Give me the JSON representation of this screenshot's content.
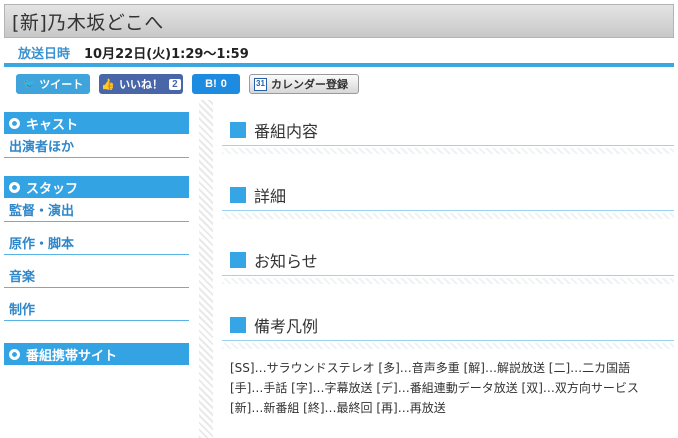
{
  "page": {
    "title": "[新]乃木坂どこへ"
  },
  "broadcast": {
    "label": "放送日時",
    "datetime": "10月22日(火)1:29～1:59"
  },
  "social": {
    "tweet_label": "ツイート",
    "like_label": "いいね！",
    "like_count": "2",
    "hatena_label": "B!",
    "hatena_count": "0",
    "calendar_icon_text": "31",
    "calendar_label": "カレンダー登録"
  },
  "sidebar": {
    "cast_heading": "キャスト",
    "cast_link": "出演者ほか",
    "staff_heading": "スタッフ",
    "staff_links": [
      "監督・演出",
      "原作・脚本",
      "音楽",
      "制作"
    ],
    "mobile_heading": "番組携帯サイト"
  },
  "main": {
    "sections": [
      "番組内容",
      "詳細",
      "お知らせ",
      "備考凡例"
    ],
    "legend_lines": [
      "[SS]…サラウンドステレオ [多]…音声多重 [解]…解説放送 [二]…二カ国語",
      "[手]…手話 [字]…字幕放送 [デ]…番組連動データ放送 [双]…双方向サービス",
      "[新]…新番組 [終]…最終回 [再]…再放送"
    ]
  },
  "colors": {
    "accent": "#33a3e4",
    "link": "#2f86c9",
    "twitter": "#3fa4dc",
    "facebook": "#4866a8",
    "hatena": "#1d8be0"
  }
}
